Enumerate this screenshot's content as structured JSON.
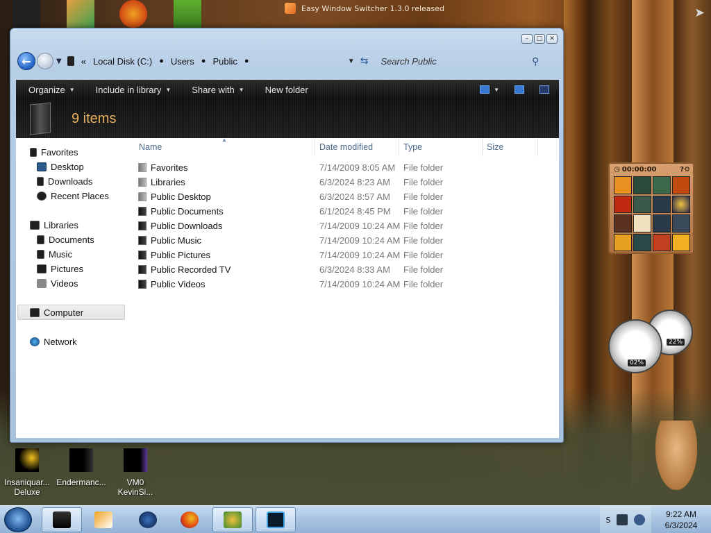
{
  "notification": {
    "text": "Easy Window Switcher 1.3.0 released"
  },
  "window": {
    "address": {
      "crumbs": [
        "Local Disk (C:)",
        "Users",
        "Public"
      ],
      "overflow": "«"
    },
    "search": {
      "placeholder": "Search Public"
    },
    "toolbar": {
      "organize": "Organize",
      "include_in_library": "Include in library",
      "share_with": "Share with",
      "new_folder": "New folder"
    },
    "details": {
      "item_count": "9 items"
    },
    "nav": {
      "favorites": "Favorites",
      "desktop": "Desktop",
      "downloads": "Downloads",
      "recent_places": "Recent Places",
      "libraries": "Libraries",
      "documents": "Documents",
      "music": "Music",
      "pictures": "Pictures",
      "videos": "Videos",
      "computer": "Computer",
      "network": "Network"
    },
    "columns": {
      "name": "Name",
      "date_modified": "Date modified",
      "type": "Type",
      "size": "Size"
    },
    "files": [
      {
        "name": "Favorites",
        "date": "7/14/2009 8:05 AM",
        "type": "File folder"
      },
      {
        "name": "Libraries",
        "date": "6/3/2024 8:23 AM",
        "type": "File folder"
      },
      {
        "name": "Public Desktop",
        "date": "6/3/2024 8:57 AM",
        "type": "File folder"
      },
      {
        "name": "Public Documents",
        "date": "6/1/2024 8:45 PM",
        "type": "File folder"
      },
      {
        "name": "Public Downloads",
        "date": "7/14/2009 10:24 AM",
        "type": "File folder"
      },
      {
        "name": "Public Music",
        "date": "7/14/2009 10:24 AM",
        "type": "File folder"
      },
      {
        "name": "Public Pictures",
        "date": "7/14/2009 10:24 AM",
        "type": "File folder"
      },
      {
        "name": "Public Recorded TV",
        "date": "6/3/2024 8:33 AM",
        "type": "File folder"
      },
      {
        "name": "Public Videos",
        "date": "7/14/2009 10:24 AM",
        "type": "File folder"
      }
    ]
  },
  "gadgets": {
    "puzzle_timer": "00:00:00",
    "cpu_percent": "02%",
    "ram_percent": "22%"
  },
  "desktop_icons": [
    {
      "line1": "Insaniquar...",
      "line2": "Deluxe"
    },
    {
      "line1": "Endermanc...",
      "line2": ""
    },
    {
      "line1": "VM0",
      "line2": "KevinSi..."
    }
  ],
  "taskbar": {
    "time": "9:22 AM",
    "date": "6/3/2024",
    "tray_label": "S"
  },
  "colors": {
    "item_count": "#e8b060",
    "taskbar": "#a7c3e0",
    "column_header": "#4a6a8a"
  }
}
